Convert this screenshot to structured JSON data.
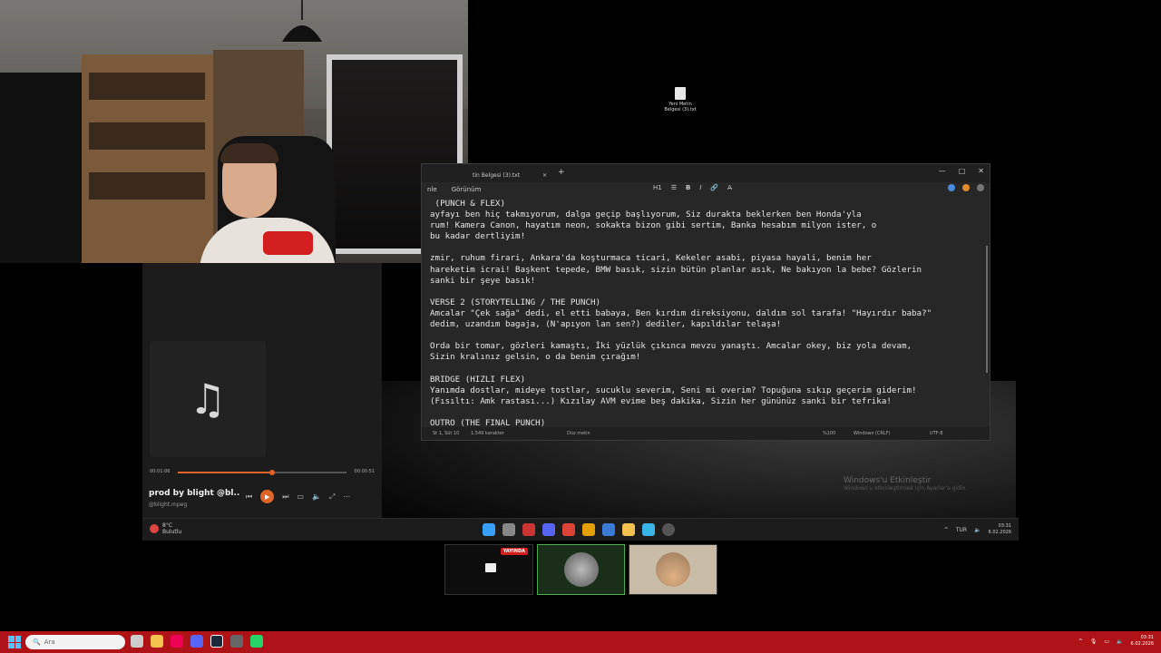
{
  "desktop": {
    "file_name": "Yeni Metin Belgesi (3).txt",
    "watermark_title": "Windows'u Etkinleştir",
    "watermark_sub": "Windows'u etkinleştirmek için Ayarlar'a gidin."
  },
  "notepad": {
    "tab_title": "tin Belgesi (3).txt",
    "tab_close": "×",
    "new_tab": "+",
    "menu": [
      "nle",
      "Görünüm"
    ],
    "format": {
      "heading": "H1",
      "list": "☰",
      "bold": "B",
      "italic": "I",
      "link": "🔗",
      "clear": "A̶"
    },
    "lines": [
      " (PUNCH & FLEX)",
      "ayfayı ben hiç takmıyorum, dalga geçip başlıyorum, Siz durakta beklerken ben Honda'yla",
      "rum! Kamera Canon, hayatım neon, sokakta bizon gibi sertim, Banka hesabım milyon ister, o",
      "bu kadar dertliyim!",
      "",
      "zmir, ruhum firari, Ankara'da koşturmaca ticari, Kekeler asabi, piyasa hayali, benim her",
      "hareketim icrai! Başkent tepede, BMW basık, sizin bütün planlar asık, Ne bakıyon la bebe? Gözlerin",
      "sanki bir şeye basık!",
      "",
      "VERSE 2 (STORYTELLING / THE PUNCH)",
      "Amcalar \"Çek sağa\" dedi, el etti babaya, Ben kırdım direksiyonu, daldım sol tarafa! \"Hayırdır baba?\"",
      "dedim, uzandım bagaja, (N'apıyon lan sen?) dediler, kapıldılar telaşa!",
      "",
      "Orda bir tomar, gözleri kamaştı, İki yüzlük çıkınca mevzu yanaştı. Amcalar okey, biz yola devam,",
      "Sizin kralınız gelsin, o da benim çırağım!",
      "",
      "BRIDGE (HIZLI FLEX)",
      "Yanımda dostlar, mideye tostlar, sucuklu severim, Seni mi overim? Topuğuna sıkıp geçerim giderim!",
      "(Fısıltı: Amk rastası...) Kızılay AVM evime beş dakika, Sizin her gününüz sanki bir tefrika!",
      "",
      "OUTRO (THE FINAL PUNCH)"
    ],
    "status": {
      "position": "St 1, Süt 10",
      "chars": "1.549 karakter",
      "mode": "Düz metin",
      "zoom": "%100",
      "eol": "Windows (CRLF)",
      "encoding": "UTF-8"
    }
  },
  "player": {
    "elapsed": "00:01:06",
    "total": "00:00:51",
    "progress": 0.56,
    "title": "prod by blight @bl...",
    "file": "@blight.mpeg",
    "play_icon": "▶",
    "prev_icon": "⏮",
    "next_icon": "⏭",
    "note_icon": "♫"
  },
  "taskbar2": {
    "temp": "8°C",
    "weather": "Bulutlu",
    "lang": "TUR",
    "time": "03:31",
    "date": "6.02.2026"
  },
  "thumbnails": {
    "live_badge": "YAYINDA"
  },
  "taskbar": {
    "search_placeholder": "Ara",
    "time": "03:31",
    "date": "6.02.2026"
  },
  "outer_controls": [
    "—",
    "□",
    "✕"
  ],
  "colors": {
    "accent": "#e0642a",
    "taskbar": "#b01317",
    "live": "#d41f1f"
  }
}
